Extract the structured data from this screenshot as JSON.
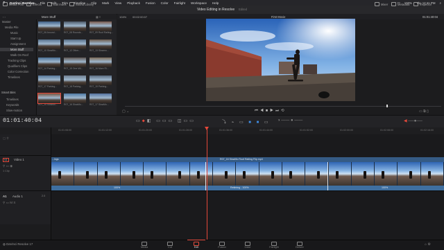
{
  "menubar": {
    "app": "DaVinci Resolve",
    "items": [
      "File",
      "Edit",
      "Trim",
      "Timeline",
      "Clip",
      "Mark",
      "View",
      "Playback",
      "Fusion",
      "Color",
      "Fairlight",
      "Workspace",
      "Help"
    ],
    "right": [
      "100%",
      "Thu 12:41 PM"
    ]
  },
  "toolbar": {
    "left": [
      "Media Pool",
      "Effects",
      "Edit Index",
      "Sound Library"
    ],
    "title": "Video Editing in Resolve",
    "subtitle": "Edited",
    "right": [
      "Mixer",
      "Metadata",
      "Inspector"
    ]
  },
  "media_pool": {
    "header": "More Stuff",
    "zoom": "104%",
    "timecode_src": "00:02:00:07",
    "tree": [
      {
        "label": "Master",
        "indent": 0,
        "selected": false
      },
      {
        "label": "Media Pile",
        "indent": 1,
        "selected": false
      },
      {
        "label": "Music",
        "indent": 2,
        "selected": false
      },
      {
        "label": "Start Up",
        "indent": 2,
        "selected": false
      },
      {
        "label": "Assignment",
        "indent": 2,
        "selected": false
      },
      {
        "label": "More Stuff",
        "indent": 2,
        "selected": true
      },
      {
        "label": "Walk On Roof",
        "indent": 2,
        "selected": false
      },
      {
        "label": "Tracking Clips",
        "indent": 1,
        "selected": false
      },
      {
        "label": "Qualifiers Clips",
        "indent": 1,
        "selected": false
      },
      {
        "label": "Color Correction",
        "indent": 1,
        "selected": false
      },
      {
        "label": "Timelines",
        "indent": 1,
        "selected": false
      }
    ],
    "smart_bins_title": "Smart Bins",
    "smart_bins": [
      "Timelines",
      "Keywords",
      "Slow-motion"
    ],
    "clips": [
      "R07_06 Around...",
      "R07_08 Rounds...",
      "R07_09 Roof Railing...",
      "R07_10 SlowMo...",
      "R07_12 Other...",
      "R07_13 Slowmo...",
      "R07_14 Parking...",
      "R07_15 One Mil...",
      "R07_16 More Ri...",
      "R07_17 Parking...",
      "R07_18 Parking...",
      "R07_19 Parking...",
      "R07_14 SlowMo...",
      "R07_16 SlowMo...",
      "R07_17 SlowMo..."
    ],
    "clip_colors": [
      "#3e5f86",
      "#4c5a68",
      "#7a5a4c",
      "#56708c",
      "#556c84",
      "#6c5a4a",
      "#4a6f93",
      "#5e5450",
      "#7d6b58",
      "#567799",
      "#6f7e90",
      "#596a7d",
      "#78543f",
      "#4f7aa5",
      "#5573a0"
    ]
  },
  "viewer": {
    "title": "First Movie",
    "timecode": "01:01:40:04"
  },
  "timeline": {
    "timecode": "01:01:40:04",
    "ruler": [
      "01:01:08:00",
      "01:01:12:00",
      "01:01:20:00",
      "01:01:28:00",
      "01:01:36:00",
      "01:01:44:00",
      "01:01:52:00",
      "01:02:00:00",
      "01:02:08:00",
      "01:02:16:00"
    ],
    "tracks": {
      "v1_label": "Video 1",
      "v1_badge": "V1",
      "v1_clips": "1 Clip",
      "a1_label": "Audio 1",
      "a1_badge": "A1",
      "a1_value": "2.0"
    },
    "clip_name": "R07_16 SlowMo Roof Railing Flip.mp4",
    "clip_left_label": "...ings",
    "speed_labels": [
      "100%",
      "Retiming - 100%",
      "100%"
    ]
  },
  "pages": [
    {
      "label": "Media",
      "active": false
    },
    {
      "label": "Cut",
      "active": false
    },
    {
      "label": "Edit",
      "active": true
    },
    {
      "label": "Fusion",
      "active": false
    },
    {
      "label": "Color",
      "active": false
    },
    {
      "label": "Fairlight",
      "active": false
    },
    {
      "label": "Deliver",
      "active": false
    }
  ],
  "footer": {
    "app_version": "DaVinci Resolve 17"
  },
  "colors": {
    "accent": "#e5483a",
    "video_track": "#3f6fa0",
    "selected_clip_border": "#e5483a"
  }
}
